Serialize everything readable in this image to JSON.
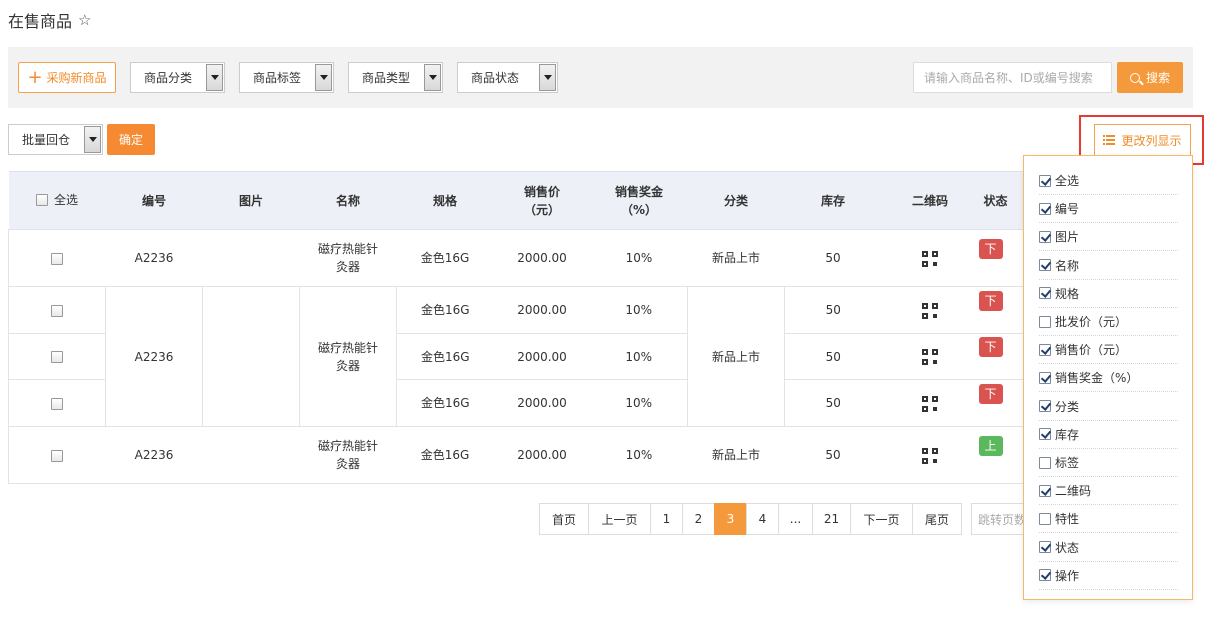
{
  "page": {
    "title": "在售商品",
    "star_icon": "star-outline-icon"
  },
  "toolbar": {
    "new_button": "采购新商品",
    "filters": [
      "商品分类",
      "商品标签",
      "商品类型",
      "商品状态"
    ],
    "search_placeholder": "请输入商品名称、ID或编号搜索",
    "search_button": "搜索"
  },
  "batch": {
    "action": "批量回仓",
    "confirm": "确定"
  },
  "column_display": {
    "label": "更改列显示"
  },
  "table": {
    "headers": {
      "select_all": "全选",
      "number": "编号",
      "image": "图片",
      "name": "名称",
      "spec": "规格",
      "price_l1": "销售价",
      "price_l2": "（元）",
      "bonus_l1": "销售奖金",
      "bonus_l2": "（%）",
      "category": "分类",
      "stock": "库存",
      "qrcode": "二维码",
      "status": "状态"
    },
    "groups": [
      {
        "number": "A2236",
        "name": "磁疗热能针灸器",
        "category": "新品上市",
        "rows": [
          {
            "spec": "金色16G",
            "price": "2000.00",
            "bonus": "10%",
            "stock": "50",
            "status": "下架"
          }
        ]
      },
      {
        "number": "A2236",
        "name": "磁疗热能针灸器",
        "category": "新品上市",
        "rows": [
          {
            "spec": "金色16G",
            "price": "2000.00",
            "bonus": "10%",
            "stock": "50",
            "status": "下架"
          },
          {
            "spec": "金色16G",
            "price": "2000.00",
            "bonus": "10%",
            "stock": "50",
            "status": "下架"
          },
          {
            "spec": "金色16G",
            "price": "2000.00",
            "bonus": "10%",
            "stock": "50",
            "status": "下架"
          }
        ]
      },
      {
        "number": "A2236",
        "name": "磁疗热能针灸器",
        "category": "新品上市",
        "rows": [
          {
            "spec": "金色16G",
            "price": "2000.00",
            "bonus": "10%",
            "stock": "50",
            "status": "上架"
          }
        ]
      }
    ]
  },
  "pagination": {
    "pages": [
      "首页",
      "上一页",
      "1",
      "2",
      "3",
      "4",
      "...",
      "21",
      "下一页",
      "尾页"
    ],
    "current": "3",
    "jump_placeholder": "跳转页数"
  },
  "column_options": [
    {
      "label": "全选",
      "checked": true
    },
    {
      "label": "编号",
      "checked": true
    },
    {
      "label": "图片",
      "checked": true
    },
    {
      "label": "名称",
      "checked": true
    },
    {
      "label": "规格",
      "checked": true
    },
    {
      "label": "批发价（元）",
      "checked": false
    },
    {
      "label": "销售价（元）",
      "checked": true
    },
    {
      "label": "销售奖金（%）",
      "checked": true
    },
    {
      "label": "分类",
      "checked": true
    },
    {
      "label": "库存",
      "checked": true
    },
    {
      "label": "标签",
      "checked": false
    },
    {
      "label": "二维码",
      "checked": true
    },
    {
      "label": "特性",
      "checked": false
    },
    {
      "label": "状态",
      "checked": true
    },
    {
      "label": "操作",
      "checked": true
    }
  ],
  "colors": {
    "accent": "#f59a3c",
    "highlight_box": "#e53935",
    "status_down": "#d9534f",
    "status_up": "#5cb85c"
  }
}
